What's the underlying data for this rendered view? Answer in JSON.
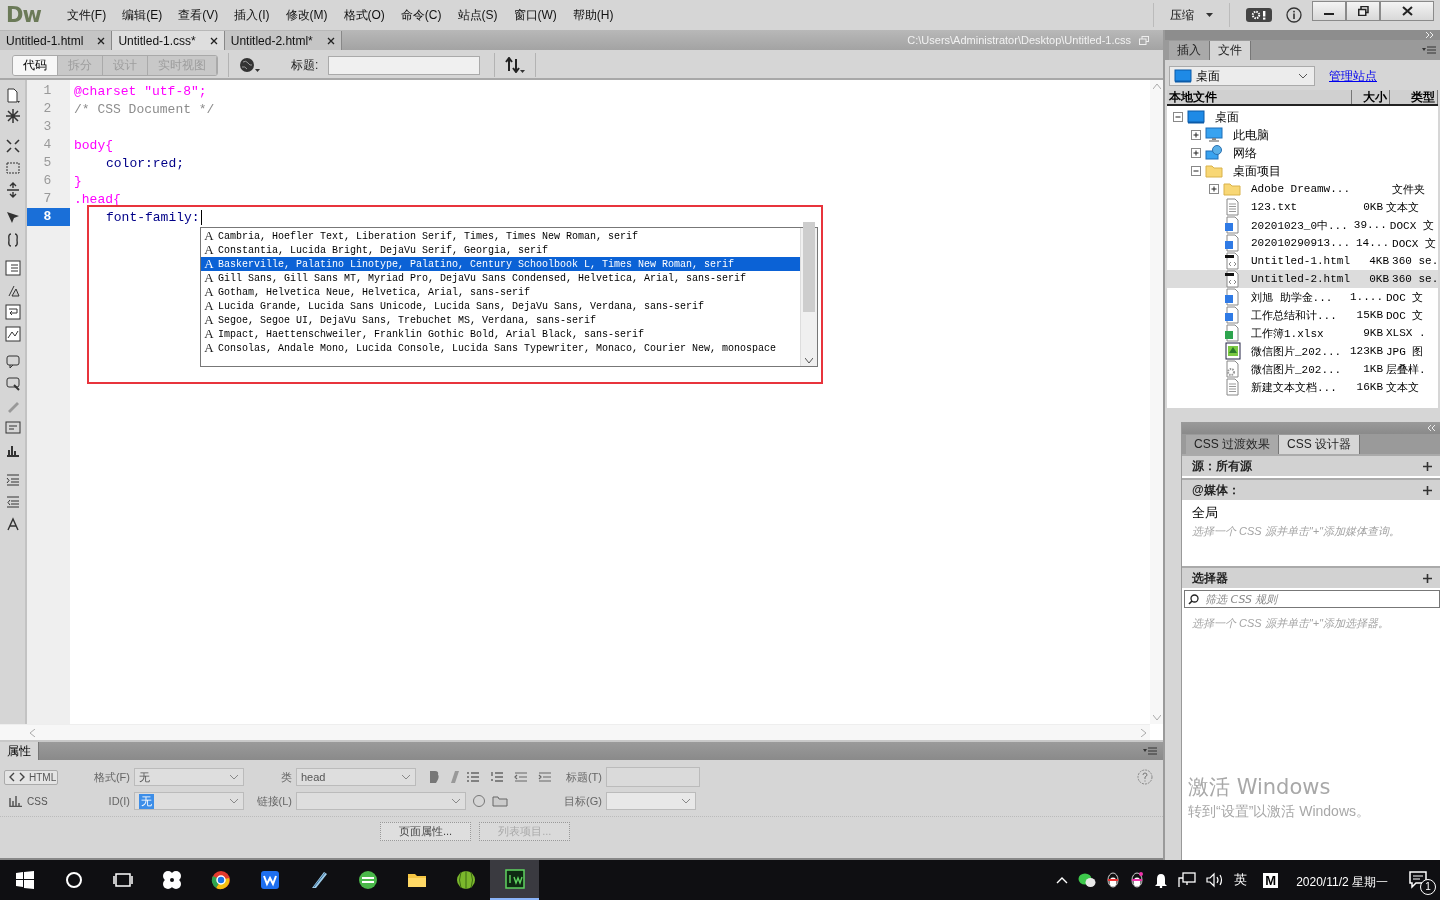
{
  "app": {
    "logo": "Dw",
    "menus": [
      "文件(F)",
      "编辑(E)",
      "查看(V)",
      "插入(I)",
      "修改(M)",
      "格式(O)",
      "命令(C)",
      "站点(S)",
      "窗口(W)",
      "帮助(H)"
    ],
    "workspace": "压缩"
  },
  "document_tabs": [
    {
      "label": "Untitled-1.html",
      "selected": false
    },
    {
      "label": "Untitled-1.css*",
      "selected": true
    },
    {
      "label": "Untitled-2.html*",
      "selected": false
    }
  ],
  "file_path": "C:\\Users\\Administrator\\Desktop\\Untitled-1.css",
  "view_buttons": [
    {
      "label": "代码",
      "selected": true,
      "disabled": false
    },
    {
      "label": "拆分",
      "selected": false,
      "disabled": true
    },
    {
      "label": "设计",
      "selected": false,
      "disabled": true
    },
    {
      "label": "实时视图",
      "selected": false,
      "disabled": true
    }
  ],
  "title_field": {
    "label": "标题:"
  },
  "code_lines": [
    {
      "number": "1",
      "kind": "at-rule",
      "text": "@charset \"utf-8\";",
      "current": false
    },
    {
      "number": "2",
      "kind": "comment",
      "text": "/* CSS Document */",
      "current": false
    },
    {
      "number": "3",
      "kind": "blank",
      "current": false
    },
    {
      "number": "4",
      "kind": "selector",
      "text": "body{",
      "current": false
    },
    {
      "number": "5",
      "kind": "declaration",
      "text": "color:red;",
      "current": false
    },
    {
      "number": "6",
      "kind": "close",
      "text": "}",
      "current": false
    },
    {
      "number": "7",
      "kind": "selector",
      "text": ".head{",
      "current": false
    },
    {
      "number": "8",
      "kind": "declaration",
      "text": "font-family:",
      "current": true
    }
  ],
  "code_hints": [
    {
      "icon": "A",
      "text": "Cambria, Hoefler Text, Liberation Serif, Times, Times New Roman, serif",
      "selected": false
    },
    {
      "icon": "A",
      "text": "Constantia, Lucida Bright, DejaVu Serif, Georgia, serif",
      "selected": false
    },
    {
      "icon": "A",
      "text": "Baskerville, Palatino Linotype, Palatino, Century Schoolbook L, Times New Roman, serif",
      "selected": true
    },
    {
      "icon": "A",
      "text": "Gill Sans, Gill Sans MT, Myriad Pro, DejaVu Sans Condensed, Helvetica, Arial, sans-serif",
      "selected": false
    },
    {
      "icon": "A",
      "text": "Gotham, Helvetica Neue, Helvetica, Arial, sans-serif",
      "selected": false
    },
    {
      "icon": "A",
      "text": "Lucida Grande, Lucida Sans Unicode, Lucida Sans, DejaVu Sans, Verdana, sans-serif",
      "selected": false
    },
    {
      "icon": "A",
      "text": "Segoe, Segoe UI, DejaVu Sans, Trebuchet MS, Verdana, sans-serif",
      "selected": false
    },
    {
      "icon": "A",
      "text": "Impact, Haettenschweiler, Franklin Gothic Bold, Arial Black, sans-serif",
      "selected": false
    },
    {
      "icon": "A",
      "text": "Consolas, Andale Mono, Lucida Console, Lucida Sans Typewriter, Monaco, Courier New, monospace",
      "selected": false
    }
  ],
  "files_panel": {
    "tabs": [
      {
        "label": "插入",
        "selected": false
      },
      {
        "label": "文件",
        "selected": true
      }
    ],
    "site": "桌面",
    "manage_link": "管理站点",
    "columns": [
      "本地文件",
      "大小",
      "类型"
    ],
    "tree": [
      {
        "name": "桌面",
        "kind": "monitor",
        "expanded": true,
        "selected": false,
        "children": [
          {
            "name": "此电脑",
            "kind": "computer",
            "expanded": false,
            "selected": false
          },
          {
            "name": "网络",
            "kind": "network",
            "expanded": false,
            "selected": false
          },
          {
            "name": "桌面项目",
            "kind": "folder",
            "expanded": true,
            "selected": false,
            "children": [
              {
                "name": "Adobe Dreamw...",
                "kind": "folder",
                "expanded": false,
                "type": "文件夹",
                "selected": false
              },
              {
                "name": "123.txt",
                "kind": "text",
                "size": "0KB",
                "type": "文本文",
                "selected": false
              },
              {
                "name": "20201023_0中...",
                "kind": "word",
                "size": "39...",
                "type": "DOCX 文",
                "selected": false
              },
              {
                "name": "202010290913...",
                "kind": "word",
                "size": "14...",
                "type": "DOCX 文",
                "selected": false
              },
              {
                "name": "Untitled-1.html",
                "kind": "html",
                "size": "4KB",
                "type": "360 se.",
                "selected": false
              },
              {
                "name": "Untitled-2.html",
                "kind": "html",
                "size": "0KB",
                "type": "360 se.",
                "selected": true
              },
              {
                "name": "刘旭 助学金...",
                "kind": "word",
                "size": "1....",
                "type": "DOC 文",
                "selected": false
              },
              {
                "name": "工作总结和计...",
                "kind": "word",
                "size": "15KB",
                "type": "DOC 文",
                "selected": false
              },
              {
                "name": "工作簿1.xlsx",
                "kind": "excel",
                "size": "9KB",
                "type": "XLSX .",
                "selected": false
              },
              {
                "name": "微信图片_202...",
                "kind": "image",
                "size": "123KB",
                "type": "JPG 图",
                "selected": false
              },
              {
                "name": "微信图片_202...",
                "kind": "stylesheet",
                "size": "1KB",
                "type": "层叠样.",
                "selected": false
              },
              {
                "name": "新建文本文档...",
                "kind": "text",
                "size": "16KB",
                "type": "文本文",
                "selected": false
              }
            ]
          }
        ]
      }
    ]
  },
  "css_designer": {
    "tabs": [
      {
        "label": "CSS 过渡效果",
        "selected": false
      },
      {
        "label": "CSS 设计器",
        "selected": true
      }
    ],
    "source_header": "源：所有源",
    "media_header": "@媒体：",
    "media_items": [
      "全局"
    ],
    "media_hint": "选择一个 CSS 源并单击\"+\"添加媒体查询。",
    "selectors_header": "选择器",
    "filter_placeholder": "筛选 CSS 规则",
    "selectors_hint": "选择一个 CSS 源并单击\"+\"添加选择器。"
  },
  "properties": {
    "tab": "属性",
    "mode_buttons": [
      {
        "label": "HTML",
        "selected": true
      },
      {
        "label": "CSS",
        "selected": false
      }
    ],
    "format_label": "格式(F)",
    "format_value": "无",
    "id_label": "ID(I)",
    "id_value": "无",
    "class_label": "类",
    "class_value": "head",
    "link_label": "链接(L)",
    "title_label": "标题(T)",
    "target_label": "目标(G)",
    "buttons": [
      {
        "label": "页面属性...",
        "disabled": false
      },
      {
        "label": "列表项目...",
        "disabled": true
      }
    ]
  },
  "taskbar": {
    "ime": "英",
    "ime_mode": "M",
    "date": "2020/11/2 星期一",
    "notification_count": "1"
  },
  "activation_notice": {
    "title": "激活 Windows",
    "text": "转到“设置”以激活 Windows。"
  }
}
